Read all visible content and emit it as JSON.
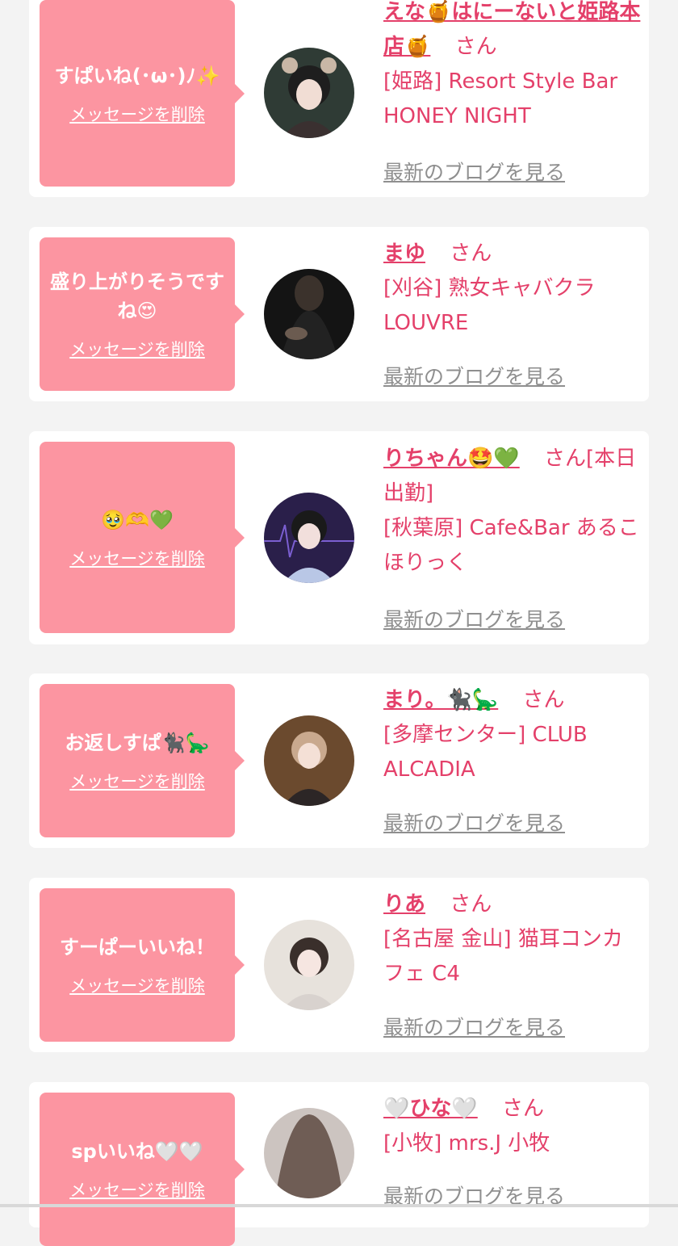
{
  "cards": [
    {
      "message": "すぱいね(･ω･)ﾉ✨",
      "delete_label": "メッセージを削除",
      "name": "えな🍯はにーないと姫路本店🍯",
      "honorific": "さん",
      "shop": "[姫路] Resort Style Bar HONEY NIGHT",
      "blog_label": "最新のブログを見る"
    },
    {
      "message": "盛り上がりそうですね😍",
      "delete_label": "メッセージを削除",
      "name": "まゆ",
      "honorific": "さん",
      "shop": "[刈谷] 熟女キャバクラ LOUVRE",
      "blog_label": "最新のブログを見る"
    },
    {
      "message": "🥹🫶💚",
      "delete_label": "メッセージを削除",
      "name": "りちゃん🤩💚",
      "honorific": "さん[本日出勤]",
      "shop": "[秋葉原] Cafe&Bar あるこほりっく",
      "blog_label": "最新のブログを見る"
    },
    {
      "message": "お返しすぱ🐈‍⬛🦕",
      "delete_label": "メッセージを削除",
      "name": "まり。🐈‍⬛🦕",
      "honorific": "さん",
      "shop": "[多摩センター] CLUB ALCADIA",
      "blog_label": "最新のブログを見る"
    },
    {
      "message": "すーぱーいいね！",
      "delete_label": "メッセージを削除",
      "name": "りあ",
      "honorific": "さん",
      "shop": "[名古屋 金山] 猫耳コンカフェ C4",
      "blog_label": "最新のブログを見る"
    },
    {
      "message": "spいいね🤍🤍",
      "delete_label": "メッセージを削除",
      "name": "🤍ひな🤍",
      "honorific": "さん",
      "shop": "[小牧] mrs.J 小牧",
      "blog_label": "最新のブログを見る"
    }
  ],
  "colors": {
    "accent": "#e4406a",
    "bubble": "#fc95a1",
    "link_gray": "#8f8f8f",
    "background": "#f3f3f3"
  }
}
